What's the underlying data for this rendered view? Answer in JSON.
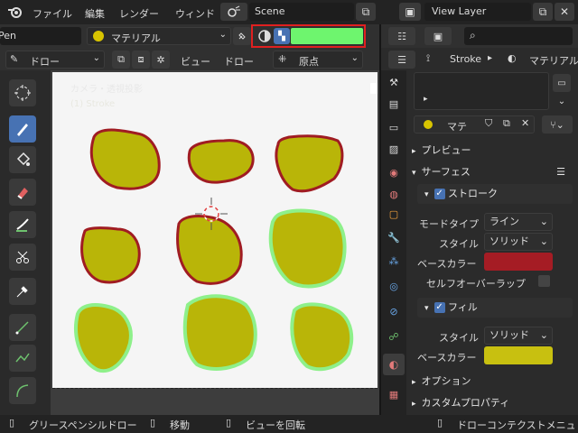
{
  "topbar": {
    "menu": [
      "ファイル",
      "編集",
      "レンダー",
      "ウィンド"
    ],
    "scene_label": "Scene",
    "view_layer_label": "View Layer"
  },
  "header": {
    "object_name": "Pen",
    "material_label": "マテリアル",
    "mode_label": "ドロー",
    "view_menu": "ビュー",
    "draw_menu": "ドロー",
    "origin_label": "原点",
    "active_color": "#6ef56e"
  },
  "viewport": {
    "overlay_title": "カメラ・透視投影",
    "overlay_sub": "(1) Stroke",
    "stroke_red": "#a01c22",
    "fill_yellow": "#b9b508",
    "stroke_green": "#8ef08a"
  },
  "properties": {
    "breadcrumb_object": "Stroke",
    "breadcrumb_material": "マテリアル",
    "slot_label": "マテ",
    "sections": {
      "preview": "プレビュー",
      "surface": "サーフェス",
      "stroke": "ストローク",
      "fill": "フィル",
      "options": "オプション",
      "custom_props": "カスタムプロパティ"
    },
    "stroke_rows": {
      "mode_type_label": "モードタイプ",
      "mode_type_value": "ライン",
      "style_label": "スタイル",
      "style_value": "ソリッド",
      "base_color_label": "ベースカラー",
      "base_color": "#a51c24",
      "self_overlap_label": "セルフオーバーラップ"
    },
    "fill_rows": {
      "style_label": "スタイル",
      "style_value": "ソリッド",
      "base_color_label": "ベースカラー",
      "base_color": "#c8c010"
    }
  },
  "statusbar": {
    "item1": "グリースペンシルドロー",
    "item2": "移動",
    "item3": "ビューを回転",
    "item4": "ドローコンテクストメニュ"
  }
}
